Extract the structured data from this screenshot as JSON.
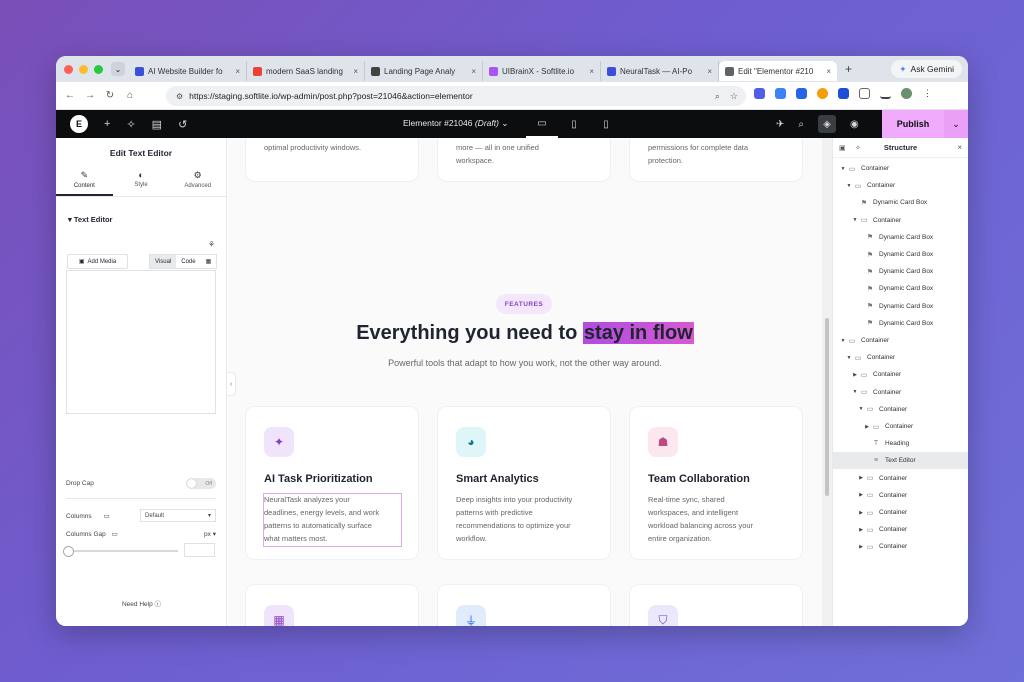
{
  "browser": {
    "tabs": [
      {
        "title": "AI Website Builder fo",
        "color": "#3b4fd8"
      },
      {
        "title": "modern SaaS landing",
        "color": "#ea4335"
      },
      {
        "title": "Landing Page Analy",
        "color": "#444444"
      },
      {
        "title": "UIBrainX - Softlite.io",
        "color": "#a855f7"
      },
      {
        "title": "NeuralTask — AI-Po",
        "color": "#3b4fd8"
      },
      {
        "title": "Edit \"Elementor #210",
        "color": "#5f6368"
      }
    ],
    "gemini_label": "Ask Gemini",
    "url": "https://staging.softlite.io/wp-admin/post.php?post=21046&action=elementor"
  },
  "elementor_bar": {
    "doc_title": "Elementor #21046",
    "doc_status": "(Draft)",
    "publish_label": "Publish"
  },
  "left_panel": {
    "title": "Edit Text Editor",
    "tabs": [
      "Content",
      "Style",
      "Advanced"
    ],
    "section": "Text Editor",
    "add_media": "Add Media",
    "visual": "Visual",
    "code": "Code",
    "drop_cap_label": "Drop Cap",
    "drop_cap_state": "Off",
    "columns_label": "Columns",
    "columns_value": "Default",
    "columns_gap_label": "Columns Gap",
    "columns_gap_unit": "px",
    "need_help": "Need Help"
  },
  "canvas": {
    "top_cards": [
      {
        "lines": [
          "optimal productivity windows."
        ]
      },
      {
        "lines": [
          "more — all in one unified",
          "workspace."
        ]
      },
      {
        "lines": [
          "permissions for complete data",
          "protection."
        ]
      }
    ],
    "badge": "FEATURES",
    "heading_plain": "Everything you need to",
    "heading_highlight": "stay in flow",
    "subheading": "Powerful tools that adapt to how you work, not the other way around.",
    "features": [
      {
        "title": "AI Task Prioritization",
        "icon": "magic-wand-icon",
        "icon_bg": "#efe4fb",
        "icon_color": "#8a3fc0",
        "lines": [
          "NeuralTask analyzes your",
          "deadlines, energy levels, and work",
          "patterns to automatically surface",
          "what matters most."
        ]
      },
      {
        "title": "Smart Analytics",
        "icon": "pie-chart-icon",
        "icon_bg": "#dff6f8",
        "icon_color": "#0e7490",
        "lines": [
          "Deep insights into your productivity",
          "patterns with predictive",
          "recommendations to optimize your",
          "workflow."
        ]
      },
      {
        "title": "Team Collaboration",
        "icon": "team-icon",
        "icon_bg": "#fce7f0",
        "icon_color": "#be4a82",
        "lines": [
          "Real-time sync, shared",
          "workspaces, and intelligent",
          "workload balancing across your",
          "entire organization."
        ]
      }
    ],
    "bottom_icons": [
      {
        "icon": "calendar-icon",
        "bg": "#efe4fb",
        "color": "#8a3fc0"
      },
      {
        "icon": "plug-icon",
        "bg": "#e0ecfb",
        "color": "#2563eb"
      },
      {
        "icon": "shield-icon",
        "bg": "#ece8fb",
        "color": "#5b4bc4"
      }
    ]
  },
  "structure": {
    "title": "Structure",
    "nodes": [
      {
        "label": "Container",
        "indent": 0,
        "arrow": "down",
        "type": "container"
      },
      {
        "label": "Container",
        "indent": 1,
        "arrow": "down",
        "type": "container"
      },
      {
        "label": "Dynamic Card Box",
        "indent": 2,
        "arrow": "",
        "type": "widget"
      },
      {
        "label": "Container",
        "indent": 2,
        "arrow": "down",
        "type": "container"
      },
      {
        "label": "Dynamic Card Box",
        "indent": 3,
        "arrow": "",
        "type": "widget"
      },
      {
        "label": "Dynamic Card Box",
        "indent": 3,
        "arrow": "",
        "type": "widget"
      },
      {
        "label": "Dynamic Card Box",
        "indent": 3,
        "arrow": "",
        "type": "widget"
      },
      {
        "label": "Dynamic Card Box",
        "indent": 3,
        "arrow": "",
        "type": "widget"
      },
      {
        "label": "Dynamic Card Box",
        "indent": 3,
        "arrow": "",
        "type": "widget"
      },
      {
        "label": "Dynamic Card Box",
        "indent": 3,
        "arrow": "",
        "type": "widget"
      },
      {
        "label": "Container",
        "indent": 0,
        "arrow": "down",
        "type": "container"
      },
      {
        "label": "Container",
        "indent": 1,
        "arrow": "down",
        "type": "container"
      },
      {
        "label": "Container",
        "indent": 2,
        "arrow": "right",
        "type": "container"
      },
      {
        "label": "Container",
        "indent": 2,
        "arrow": "down",
        "type": "container"
      },
      {
        "label": "Container",
        "indent": 3,
        "arrow": "down",
        "type": "container"
      },
      {
        "label": "Container",
        "indent": 4,
        "arrow": "right",
        "type": "container"
      },
      {
        "label": "Heading",
        "indent": 4,
        "arrow": "",
        "type": "heading"
      },
      {
        "label": "Text Editor",
        "indent": 4,
        "arrow": "",
        "type": "text",
        "selected": true
      },
      {
        "label": "Container",
        "indent": 3,
        "arrow": "right",
        "type": "container"
      },
      {
        "label": "Container",
        "indent": 3,
        "arrow": "right",
        "type": "container"
      },
      {
        "label": "Container",
        "indent": 3,
        "arrow": "right",
        "type": "container"
      },
      {
        "label": "Container",
        "indent": 3,
        "arrow": "right",
        "type": "container"
      },
      {
        "label": "Container",
        "indent": 3,
        "arrow": "right",
        "type": "container"
      }
    ]
  }
}
